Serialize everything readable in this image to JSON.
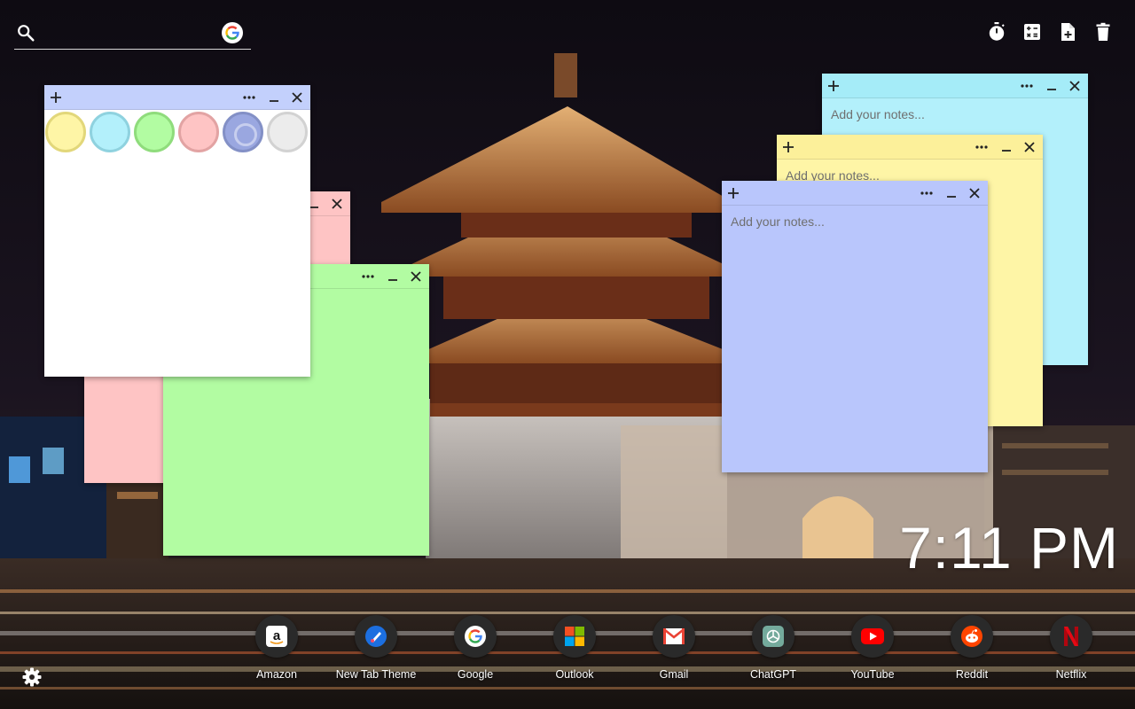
{
  "search": {
    "placeholder": "",
    "icon": "search-icon",
    "engine_icon": "google-logo"
  },
  "toolbar": {
    "items": [
      "timer-icon",
      "calculator-icon",
      "new-note-icon",
      "delete-icon"
    ]
  },
  "notes": {
    "placeholder": "Add your notes...",
    "menu_icon": "more-icon",
    "minimize_icon": "minimize-icon",
    "close_icon": "close-icon",
    "add_icon": "add-icon",
    "colors": {
      "cyan": "#b3f0fb",
      "yellow": "#fef5a6",
      "blue": "#b9c6fc",
      "pink": "#fec4c4",
      "green": "#b2fca2",
      "white": "#ffffff"
    }
  },
  "palette": {
    "swatches": [
      {
        "name": "yellow",
        "color": "#fef5a6"
      },
      {
        "name": "cyan",
        "color": "#b3f0fb"
      },
      {
        "name": "green",
        "color": "#b2fca2"
      },
      {
        "name": "pink",
        "color": "#fec4c4"
      },
      {
        "name": "blue",
        "color": "#9aa7e0",
        "selected": true
      },
      {
        "name": "white",
        "color": "#ececec"
      }
    ]
  },
  "clock": {
    "time": "7:11 PM"
  },
  "quick_links": [
    {
      "label": "Amazon",
      "icon": "amazon-icon"
    },
    {
      "label": "New Tab Theme",
      "icon": "new-tab-theme-icon"
    },
    {
      "label": "Google",
      "icon": "google-icon"
    },
    {
      "label": "Outlook",
      "icon": "outlook-icon"
    },
    {
      "label": "Gmail",
      "icon": "gmail-icon"
    },
    {
      "label": "ChatGPT",
      "icon": "chatgpt-icon"
    },
    {
      "label": "YouTube",
      "icon": "youtube-icon"
    },
    {
      "label": "Reddit",
      "icon": "reddit-icon"
    },
    {
      "label": "Netflix",
      "icon": "netflix-icon"
    }
  ],
  "settings": {
    "icon": "gear-icon"
  }
}
